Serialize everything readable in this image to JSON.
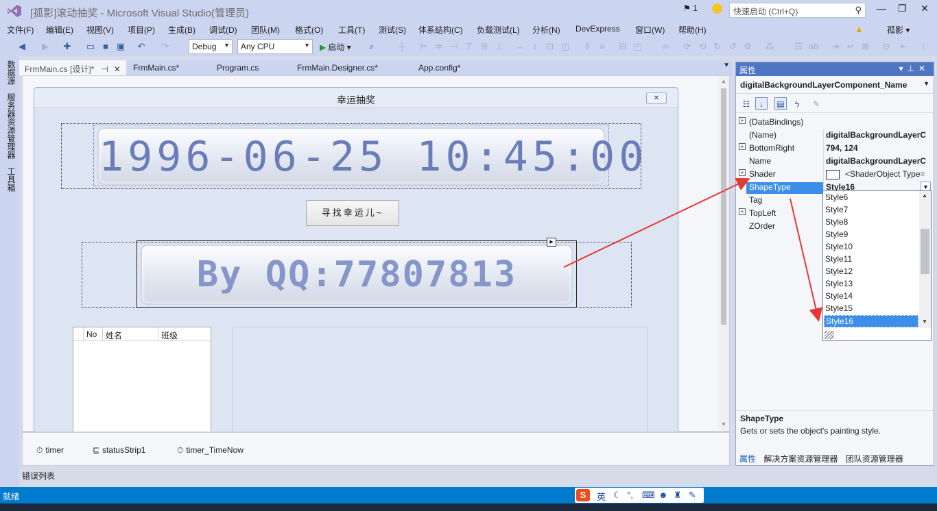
{
  "titlebar": {
    "title": "[孤影]滚动抽奖 - Microsoft Visual Studio(管理员)",
    "notifications": "1",
    "quick_launch_placeholder": "快速启动 (Ctrl+Q)",
    "minimize": "—",
    "restore": "❐",
    "close": "✕"
  },
  "menu": {
    "items": [
      "文件(F)",
      "编辑(E)",
      "视图(V)",
      "项目(P)",
      "生成(B)",
      "调试(D)",
      "团队(M)",
      "格式(O)",
      "工具(T)",
      "测试(S)",
      "体系结构(C)",
      "负载测试(L)",
      "分析(N)",
      "DevExpress",
      "窗口(W)",
      "帮助(H)"
    ],
    "user": "孤影 ▾"
  },
  "toolbar": {
    "config": "Debug",
    "platform": "Any CPU",
    "start": "启动"
  },
  "left_tabs": [
    "数据源",
    "服务器资源管理器",
    "工具箱"
  ],
  "doc_tabs": [
    "FrmMain.cs [设计]*",
    "FrmMain.cs*",
    "Program.cs",
    "FrmMain.Designer.cs*",
    "App.config*"
  ],
  "form": {
    "caption": "幸运抽奖",
    "datetime_display": "1996-06-25 10:45:00",
    "find_button": "寻找幸运儿~",
    "dot_display": "By QQ:77807813",
    "list_columns": [
      "No",
      "姓名",
      "班级"
    ]
  },
  "tray": {
    "components": [
      "timer",
      "statusStrip1",
      "timer_TimeNow"
    ]
  },
  "error_list": "错误列表",
  "properties": {
    "header": "属性",
    "object": "digitalBackgroundLayerComponent_Name",
    "rows": [
      {
        "name": "(DataBindings)",
        "value": "",
        "expand": "+"
      },
      {
        "name": "(Name)",
        "value": "digitalBackgroundLayerC",
        "expand": ""
      },
      {
        "name": "BottomRight",
        "value": "794, 124",
        "expand": "+"
      },
      {
        "name": "Name",
        "value": "digitalBackgroundLayerC",
        "expand": ""
      },
      {
        "name": "Shader",
        "value": "<ShaderObject Type=",
        "expand": "+"
      },
      {
        "name": "ShapeType",
        "value": "Style16",
        "expand": ""
      },
      {
        "name": "Tag",
        "value": "",
        "expand": ""
      },
      {
        "name": "TopLeft",
        "value": "",
        "expand": "+"
      },
      {
        "name": "ZOrder",
        "value": "",
        "expand": ""
      }
    ],
    "dropdown_options": [
      "Style6",
      "Style7",
      "Style8",
      "Style9",
      "Style10",
      "Style11",
      "Style12",
      "Style13",
      "Style14",
      "Style15",
      "Style16"
    ],
    "selected_option": "Style16",
    "desc_title": "ShapeType",
    "desc_text": "Gets or sets the object's painting style.",
    "bottom_tabs": [
      "属性",
      "解决方案资源管理器",
      "团队资源管理器"
    ]
  },
  "statusbar": {
    "text": "就绪",
    "ime_lang": "英"
  },
  "colors": {
    "accent": "#007acc",
    "selection": "#3d8ee9",
    "annotation_arrow": "#e53935"
  }
}
